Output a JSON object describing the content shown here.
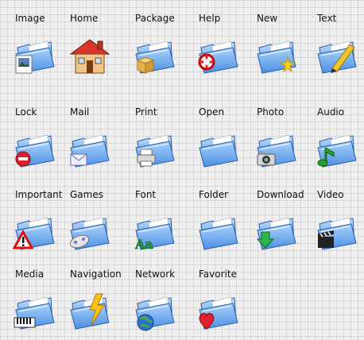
{
  "icons": [
    {
      "label": "Image",
      "icon": "image-folder-icon",
      "overlay": "image"
    },
    {
      "label": "Home",
      "icon": "home-icon",
      "overlay": "home"
    },
    {
      "label": "Package",
      "icon": "package-folder-icon",
      "overlay": "package"
    },
    {
      "label": "Help",
      "icon": "help-folder-icon",
      "overlay": "help"
    },
    {
      "label": "New",
      "icon": "new-folder-icon",
      "overlay": "new"
    },
    {
      "label": "Text",
      "icon": "text-folder-icon",
      "overlay": "text"
    },
    {
      "label": "Lock",
      "icon": "lock-folder-icon",
      "overlay": "lock"
    },
    {
      "label": "Mail",
      "icon": "mail-folder-icon",
      "overlay": "mail"
    },
    {
      "label": "Print",
      "icon": "print-folder-icon",
      "overlay": "print"
    },
    {
      "label": "Open",
      "icon": "open-folder-icon",
      "overlay": "none"
    },
    {
      "label": "Photo",
      "icon": "photo-folder-icon",
      "overlay": "photo"
    },
    {
      "label": "Audio",
      "icon": "audio-folder-icon",
      "overlay": "audio"
    },
    {
      "label": "Important",
      "icon": "important-folder-icon",
      "overlay": "important"
    },
    {
      "label": "Games",
      "icon": "games-folder-icon",
      "overlay": "games"
    },
    {
      "label": "Font",
      "icon": "font-folder-icon",
      "overlay": "font"
    },
    {
      "label": "Folder",
      "icon": "folder-icon",
      "overlay": "none"
    },
    {
      "label": "Download",
      "icon": "download-folder-icon",
      "overlay": "download"
    },
    {
      "label": "Video",
      "icon": "video-folder-icon",
      "overlay": "video"
    },
    {
      "label": "Media",
      "icon": "media-folder-icon",
      "overlay": "media"
    },
    {
      "label": "Navigation",
      "icon": "navigation-folder-icon",
      "overlay": "navigation"
    },
    {
      "label": "Network",
      "icon": "network-folder-icon",
      "overlay": "network"
    },
    {
      "label": "Favorite",
      "icon": "favorite-folder-icon",
      "overlay": "favorite"
    }
  ],
  "colors": {
    "folder_blue": "#4f8fe0",
    "folder_light": "#9cc7f5",
    "background": "#efefef",
    "grid_line": "#d7d7d7"
  }
}
